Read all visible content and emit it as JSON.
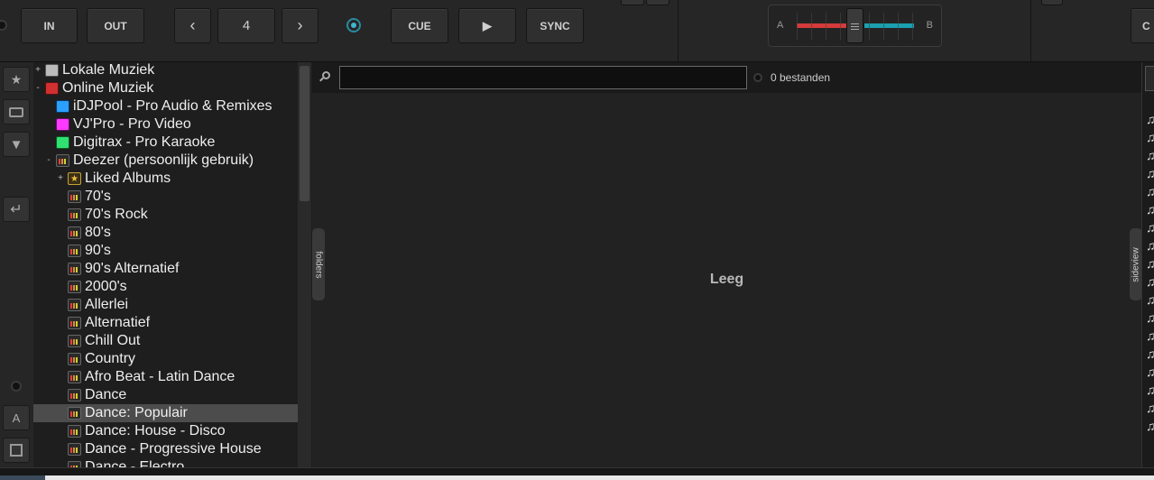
{
  "deck": {
    "in_label": "IN",
    "out_label": "OUT",
    "loop_value": "4",
    "cue_label": "CUE",
    "play_label": "▶",
    "sync_label": "SYNC",
    "prev_icon": "‹",
    "next_icon": "›",
    "right_partial_label": "C"
  },
  "mixer": {
    "side_a": "A",
    "side_b": "B",
    "crossfader_left_color": "#d63a3a",
    "crossfader_right_color": "#1aa0b0"
  },
  "tree": {
    "items": [
      {
        "label": "Lokale Muziek",
        "expander": "+",
        "icon": "computer-icon"
      },
      {
        "label": "Online Muziek",
        "expander": "-",
        "icon": "globe-icon"
      },
      {
        "label": "iDJPool - Pro Audio & Remixes",
        "expander": "",
        "icon": "idjpool-icon"
      },
      {
        "label": "VJ'Pro - Pro Video",
        "expander": "",
        "icon": "vjpro-icon"
      },
      {
        "label": "Digitrax - Pro Karaoke",
        "expander": "",
        "icon": "digitrax-icon"
      },
      {
        "label": "Deezer (persoonlijk gebruik)",
        "expander": "-",
        "icon": "deezer-icon"
      },
      {
        "label": "Liked Albums",
        "expander": "+",
        "icon": "star-folder-icon"
      },
      {
        "label": "70's",
        "expander": "",
        "icon": "playlist-icon"
      },
      {
        "label": "70's Rock",
        "expander": "",
        "icon": "playlist-icon"
      },
      {
        "label": "80's",
        "expander": "",
        "icon": "playlist-icon"
      },
      {
        "label": "90's",
        "expander": "",
        "icon": "playlist-icon"
      },
      {
        "label": "90's Alternatief",
        "expander": "",
        "icon": "playlist-icon"
      },
      {
        "label": "2000's",
        "expander": "",
        "icon": "playlist-icon"
      },
      {
        "label": "Allerlei",
        "expander": "",
        "icon": "playlist-icon"
      },
      {
        "label": "Alternatief",
        "expander": "",
        "icon": "playlist-icon"
      },
      {
        "label": "Chill Out",
        "expander": "",
        "icon": "playlist-icon"
      },
      {
        "label": "Country",
        "expander": "",
        "icon": "playlist-icon"
      },
      {
        "label": "Afro Beat - Latin Dance",
        "expander": "",
        "icon": "playlist-icon"
      },
      {
        "label": "Dance",
        "expander": "",
        "icon": "playlist-icon"
      },
      {
        "label": "Dance: Populair",
        "expander": "",
        "icon": "playlist-icon",
        "selected": true
      },
      {
        "label": "Dance: House - Disco",
        "expander": "",
        "icon": "playlist-icon"
      },
      {
        "label": "Dance - Progressive House",
        "expander": "",
        "icon": "playlist-icon"
      },
      {
        "label": "Dance - Electro",
        "expander": "",
        "icon": "playlist-icon"
      }
    ]
  },
  "browser": {
    "search_value": "",
    "file_count": "0 bestanden",
    "empty_text": "Leeg",
    "folders_tab": "folders",
    "sideview_tab": "sideview"
  },
  "rail": {
    "font_button": "A"
  },
  "sideview": {
    "note_glyph": "♫"
  }
}
